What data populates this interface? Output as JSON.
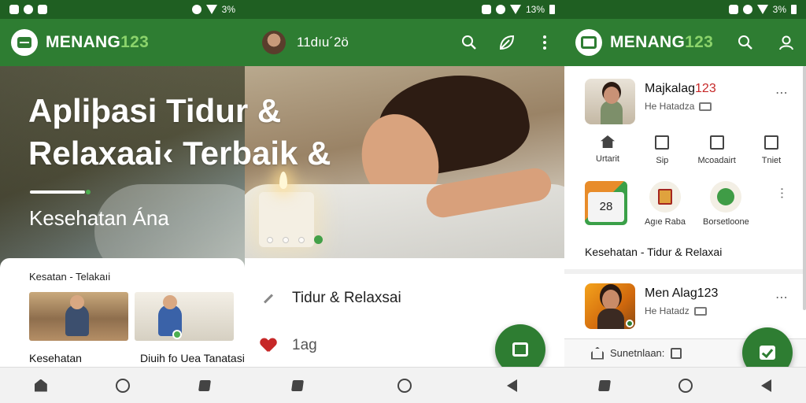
{
  "panel1": {
    "status": {
      "left_icons": [
        "notification-icon",
        "sync-icon",
        "b-icon"
      ],
      "right_text": "3%"
    },
    "appbar": {
      "brand_text": "MENANG",
      "brand_number": "123"
    },
    "hero": {
      "headline_line1": "Apliþasi Tidur &",
      "headline_line2": "Relaxaai‹ Terbaik &",
      "subheadline": "Kesehatan Ána"
    },
    "section": {
      "title": "Kesatan - Telakaıi",
      "cards": [
        {
          "label": "Kesehatan"
        },
        {
          "label": "Diuih fo Uea Tanatasi"
        }
      ]
    }
  },
  "panel2": {
    "status": {
      "right_text": "13%"
    },
    "appbar": {
      "title": "11dıu´2ö"
    },
    "carousel": {
      "count": 4,
      "active_index": 3
    },
    "rows": [
      {
        "label": "Tidur & Relaxsai"
      },
      {
        "label": "1ag"
      }
    ]
  },
  "panel3": {
    "status": {
      "right_text": "3%"
    },
    "appbar": {
      "brand_text": "MENANG",
      "brand_number": "123"
    },
    "profile1": {
      "name_prefix": "Majkalag",
      "name_number": "123",
      "subtitle": "He Hatadza"
    },
    "quick_actions": [
      {
        "label": "Urtarit",
        "icon": "house-icon"
      },
      {
        "label": "Sip",
        "icon": "chat-icon"
      },
      {
        "label": "Mcoadairt",
        "icon": "building-icon"
      },
      {
        "label": "Tniet",
        "icon": "inbox-icon"
      }
    ],
    "apps": [
      {
        "label": "28",
        "icon": "calendar-icon"
      },
      {
        "label": "Agıe Raba",
        "icon": "notebook-icon"
      },
      {
        "label": "Borsetloone",
        "icon": "globe-icon"
      }
    ],
    "section_title": "Kesehatan - Tidur & Relaxai",
    "profile2": {
      "name": "Men Alag123",
      "subtitle": "He Hatadz"
    },
    "bottom_bar": {
      "label": "Sunetnlaan:"
    }
  },
  "colors": {
    "primary": "#2e7d32",
    "primary_dark": "#1f5f22",
    "accent": "#8bd36b",
    "alert_red": "#c62828"
  }
}
